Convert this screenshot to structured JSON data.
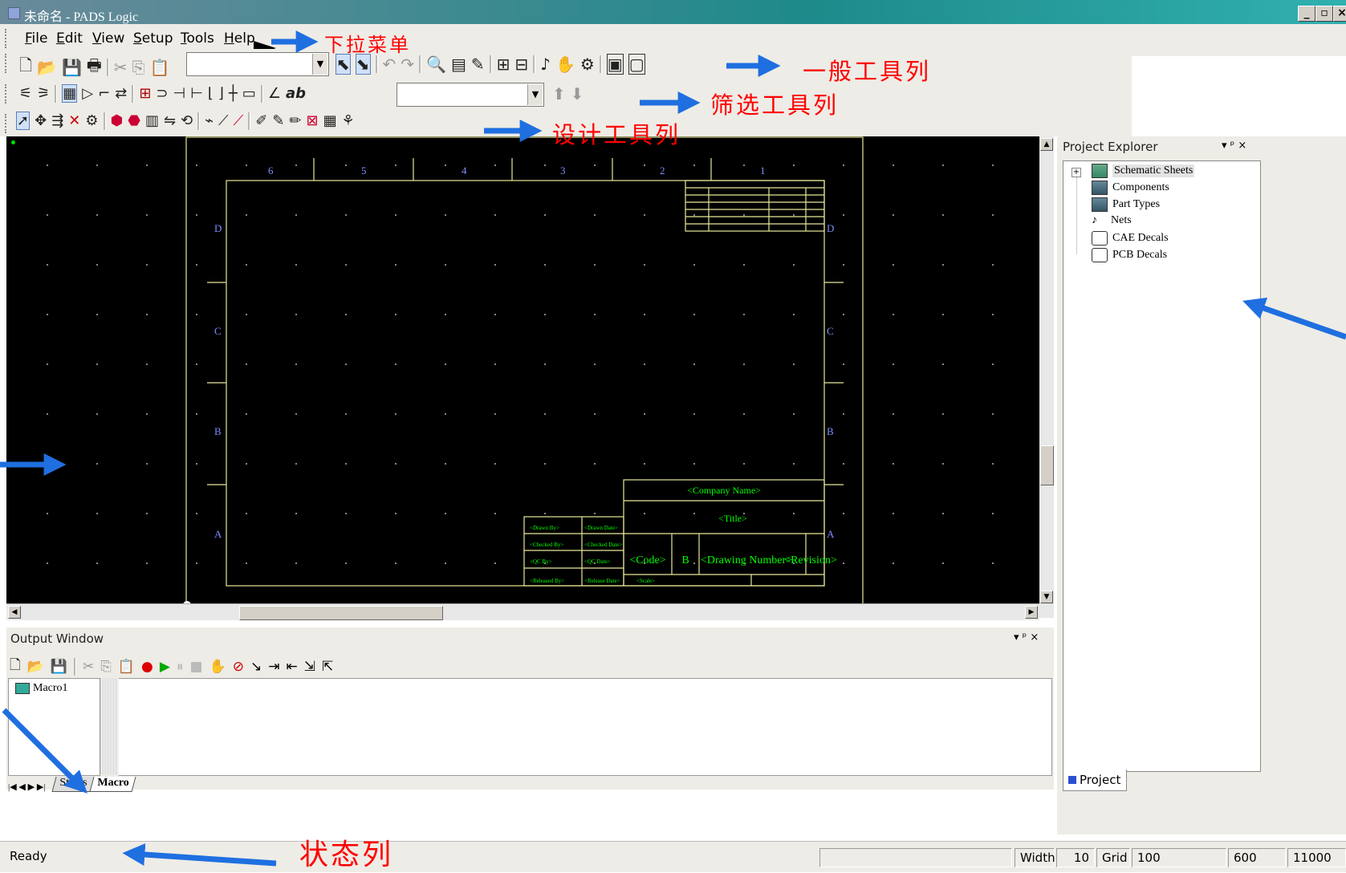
{
  "window": {
    "title": "未命名 - PADS Logic",
    "min": "_",
    "max": "▫",
    "close": "×"
  },
  "menu": {
    "items": [
      "File",
      "Edit",
      "View",
      "Setup",
      "Tools",
      "Help"
    ]
  },
  "annotations": {
    "menu": "下拉菜单",
    "general_toolbar": "一般工具列",
    "filter_toolbar": "筛选工具列",
    "design_toolbar": "设计工具列",
    "status_bar": "状态列"
  },
  "schematic": {
    "columns": [
      "6",
      "5",
      "4",
      "3",
      "2",
      "1"
    ],
    "rows": [
      "D",
      "C",
      "B",
      "A"
    ],
    "company": "<Company Name>",
    "title": "<Title>",
    "code": "<Code>",
    "size": "B",
    "drawing_number": "<Drawing Number>",
    "revision": "<Revision>",
    "drawn_by": "<Drawn By>",
    "drawn_date": "<Drawn Date>",
    "checked_by": "<Checked By>",
    "checked_date": "<Checked Date>",
    "qc_by": "<QC By>",
    "qc_date": "<QC Date>",
    "released_by": "<Released By>",
    "release_date": "<Release Date>",
    "scale": "<Scale>"
  },
  "project_explorer": {
    "title": "Project Explorer",
    "pin": "▾ ᵖ ×",
    "expand": "+",
    "items": [
      "Schematic Sheets",
      "Components",
      "Part Types",
      "Nets",
      "CAE Decals",
      "PCB Decals"
    ],
    "tab": "Project"
  },
  "output_window": {
    "title": "Output Window",
    "pin": "▾ ᵖ ×",
    "macro_item": "Macro1",
    "tabs": [
      "Status",
      "Macro"
    ],
    "nav": "|◀ ◀ ▶ ▶|"
  },
  "status": {
    "text": "Ready",
    "width_label": "Width",
    "width_value": "10",
    "grid_label": "Grid",
    "grid_value": "100",
    "x": "600",
    "y": "11000"
  },
  "colors": {
    "annotation": "#ff0000",
    "arrow": "#1f6fe0",
    "sheet_border": "#e8e89a",
    "sheet_text": "#00ff00",
    "sheet_label": "#7f8cff"
  }
}
